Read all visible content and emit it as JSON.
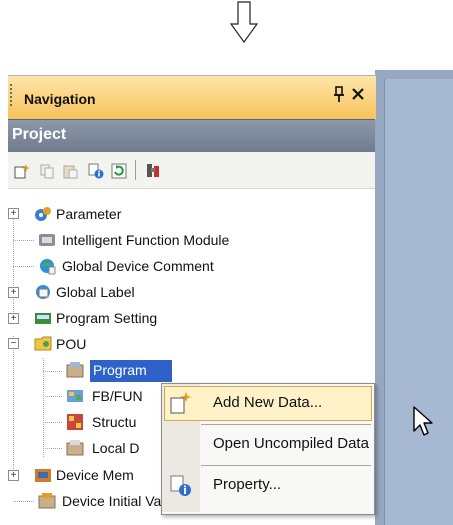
{
  "navigation": {
    "title": "Navigation",
    "pin_glyph": "ρ",
    "close_glyph": "×"
  },
  "project": {
    "title": "Project"
  },
  "toolbar": {
    "icons": [
      "new-data-icon",
      "copy-icon",
      "paste-icon",
      "property-icon",
      "refresh-icon",
      "find-icon"
    ]
  },
  "tree": {
    "items": [
      {
        "label": "Parameter",
        "icon": "parameter-icon",
        "expander": "+"
      },
      {
        "label": "Intelligent Function Module",
        "icon": "module-icon"
      },
      {
        "label": "Global Device Comment",
        "icon": "comment-icon"
      },
      {
        "label": "Global Label",
        "icon": "label-icon",
        "expander": "+"
      },
      {
        "label": "Program Setting",
        "icon": "program-setting-icon",
        "expander": "+"
      },
      {
        "label": "POU",
        "icon": "pou-folder-icon",
        "expander": "−"
      },
      {
        "label": "Program",
        "icon": "program-icon",
        "selected": true
      },
      {
        "label": "FB/FUN",
        "icon": "fb-fun-icon"
      },
      {
        "label": "Structu",
        "icon": "structure-icon"
      },
      {
        "label": "Local D",
        "icon": "local-device-icon"
      },
      {
        "label": "Device Mem",
        "icon": "device-memory-icon",
        "expander": "+"
      },
      {
        "label": "Device Initial Value",
        "icon": "device-initial-value-icon"
      }
    ]
  },
  "context_menu": {
    "items": [
      {
        "label": "Add New Data...",
        "icon": "new-data-icon",
        "highlighted": true
      },
      {
        "label": "Open Uncompiled Data"
      },
      {
        "label": "Property...",
        "icon": "property-icon"
      }
    ]
  },
  "colors": {
    "header_gradient_top": "#fde6a8",
    "header_gradient_bottom": "#f7c15a",
    "project_bar": "#7d899b",
    "selection": "#2e62c9",
    "menu_highlight": "#fff2c8"
  }
}
